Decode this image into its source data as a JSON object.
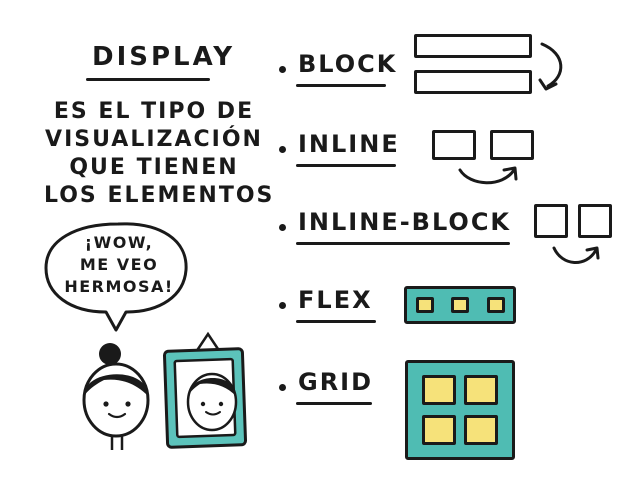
{
  "heading": "DISPLAY",
  "description": {
    "lines": [
      "ES EL TIPO DE",
      "VISUALIZACIÓN",
      "QUE TIENEN",
      "LOS ELEMENTOS"
    ]
  },
  "bubble": {
    "lines": [
      "¡WOW,",
      "ME VEO",
      "HERMOSA!"
    ]
  },
  "items": [
    {
      "label": "BLOCK"
    },
    {
      "label": "INLINE"
    },
    {
      "label": "INLINE-BLOCK"
    },
    {
      "label": "FLEX"
    },
    {
      "label": "GRID"
    }
  ],
  "colors": {
    "ink": "#1a1a1a",
    "teal": "#4fbcb3",
    "yellow": "#f6e27a",
    "mirror_teal": "#5cc3bb"
  }
}
